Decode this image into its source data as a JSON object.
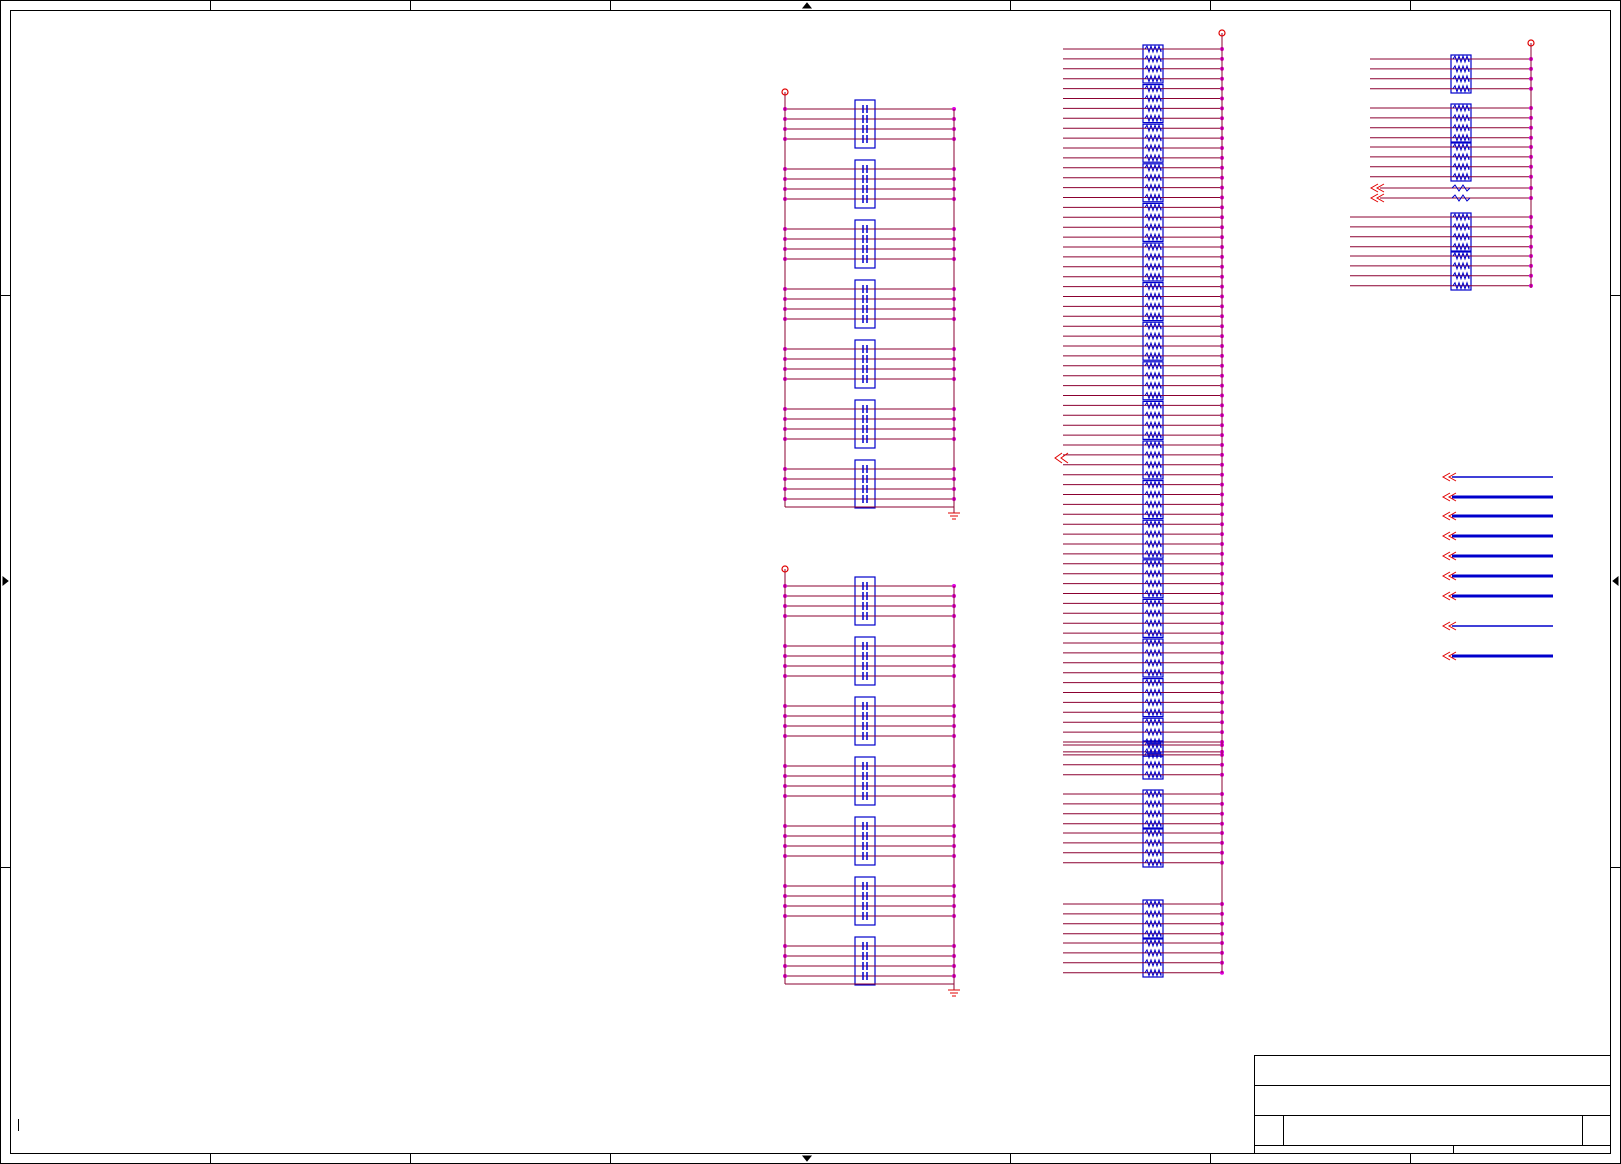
{
  "sheet": {
    "title_block": {
      "title": "",
      "rows": [
        "",
        "",
        ""
      ]
    }
  },
  "colors": {
    "border": "#000000",
    "wire": "#8b0030",
    "junction": "#e000e0",
    "component": "#0000cc",
    "power": "#e00000",
    "bus": "#0000cc"
  },
  "components": {
    "capacitor_array": {
      "icon": "capacitor-array-icon",
      "group_count": 2,
      "packs_per_group": 7
    },
    "resistor_network": {
      "icon": "resistor-network-icon"
    },
    "power_symbol": {
      "icon": "power-port-icon"
    },
    "ground_symbol": {
      "icon": "ground-icon"
    },
    "offsheet_connector": {
      "icon": "offsheet-arrow-icon"
    }
  }
}
